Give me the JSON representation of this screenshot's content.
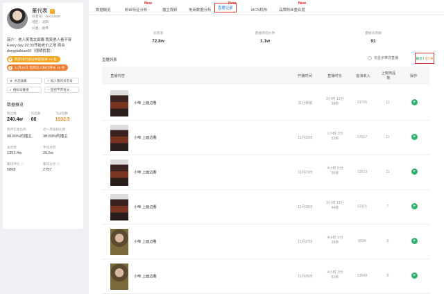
{
  "profile": {
    "name": "董代表",
    "douyin_id": "抖音号：dyxl14606",
    "region": "地区：沈阳",
    "category": "分类：搞笑",
    "bio_line1": "简介：他人笑我太疯癫 我笑他人看不穿",
    "bio_line2": "Every day 20:30开始老价之地 商合",
    "bio_line3": "dongdaibiao66（很晒找我）",
    "tag1": "购买排行榜分钟前榜单 24 名",
    "tag2": "11月20日 电商达人粉丝增长 49 名"
  },
  "actions": [
    "点击收藏",
    "加入我的抖音号",
    "相似号番组",
    "监控不开发文"
  ],
  "overview": {
    "title": "数据概览",
    "fans_label": "粉丝数",
    "fans": "240.4w",
    "works_label": "作品数",
    "works": "66",
    "likes_label": "飞瓜指数",
    "likes": "1032.5",
    "kv": [
      {
        "label": "赞评互动比例",
        "value": "98.89%的播主"
      },
      {
        "label": "近一周涨粉比例",
        "value": "98.89%的播主"
      },
      {
        "label": "总点赞",
        "value": "1351.4w"
      },
      {
        "label": "平均点赞",
        "value": "20.5w"
      },
      {
        "label": "集均评论 ⓘ",
        "value": "5868"
      },
      {
        "label": "集均分享 ⓘ",
        "value": "2757"
      }
    ]
  },
  "tabs": [
    "数据概览",
    "粉丝特征分析",
    "播主视频",
    "电商数据分析",
    "直播记录",
    "MCN机构",
    "品牌粉丝重合度"
  ],
  "new_badge": "New",
  "summary": [
    {
      "label": "总音浪",
      "value": "72.8w"
    },
    {
      "label": "直播场均分钟",
      "value": "1.1w"
    },
    {
      "label": "直播总场数",
      "value": "91"
    }
  ],
  "list": {
    "title": "直播列表",
    "filter_label": "仅显示带货直播",
    "range_a": "最近",
    "range_b": "近7天"
  },
  "columns": [
    "直播内容",
    "开播时间",
    "直播时长",
    "音浪收入",
    "上架商品数",
    "操作"
  ],
  "rows": [
    {
      "title": "小咪 上面边看",
      "date": "11分钟前",
      "duration": "2小时 13分 38秒",
      "income": "13705",
      "items": "11"
    },
    {
      "title": "小咪 上面边看",
      "date": "11月30日",
      "duration": "1小时 3分 52秒",
      "income": "17917",
      "items": "11"
    },
    {
      "title": "小咪 上面边看",
      "date": "11月29日",
      "duration": "4小时 0分 50秒",
      "income": "13523",
      "items": "11"
    },
    {
      "title": "小咪 上面边看",
      "date": "11月28日",
      "duration": "3小时 12分 44秒",
      "income": "13115",
      "items": "7"
    },
    {
      "title": "小咪 上面边看",
      "date": "11月27日",
      "duration": "4小时 9分 29秒",
      "income": "6594",
      "items": "8"
    },
    {
      "title": "小咪 上面边看",
      "date": "11月26日",
      "duration": "4小时 3分 51秒",
      "income": "13548",
      "items": "8"
    }
  ],
  "icons": {
    "verify": "verified-badge-icon",
    "operate": "play-icon"
  }
}
